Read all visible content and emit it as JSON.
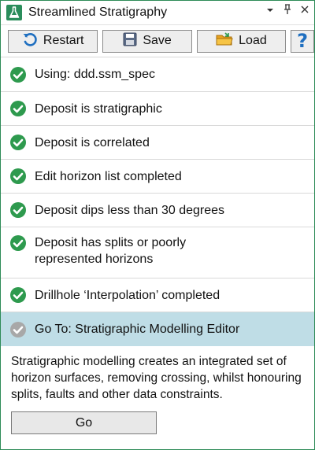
{
  "window": {
    "title": "Streamlined Stratigraphy",
    "icon": "flask-icon",
    "accent_color": "#2a8d5b"
  },
  "toolbar": {
    "restart_label": "Restart",
    "save_label": "Save",
    "load_label": "Load",
    "help_label": "?"
  },
  "steps": [
    {
      "label": "Using: ddd.ssm_spec",
      "status": "completed"
    },
    {
      "label": "Deposit is stratigraphic",
      "status": "completed"
    },
    {
      "label": "Deposit is correlated",
      "status": "completed"
    },
    {
      "label": "Edit horizon list completed",
      "status": "completed"
    },
    {
      "label": "Deposit dips less than 30 degrees",
      "status": "completed"
    },
    {
      "label_line1": "Deposit has splits or poorly",
      "label_line2": "represented horizons",
      "status": "completed"
    },
    {
      "label": "Drillhole ‘Interpolation’ completed",
      "status": "completed"
    },
    {
      "label": "Go To: Stratigraphic Modelling Editor",
      "status": "current"
    }
  ],
  "description": "Stratigraphic modelling creates an integrated set of horizon surfaces, removing crossing, whilst honouring splits, faults and other data constraints.",
  "go_button_label": "Go",
  "colors": {
    "check_green": "#2e9a4e",
    "pending_gray": "#a8a8a8",
    "active_row_bg": "#bfdde6"
  }
}
